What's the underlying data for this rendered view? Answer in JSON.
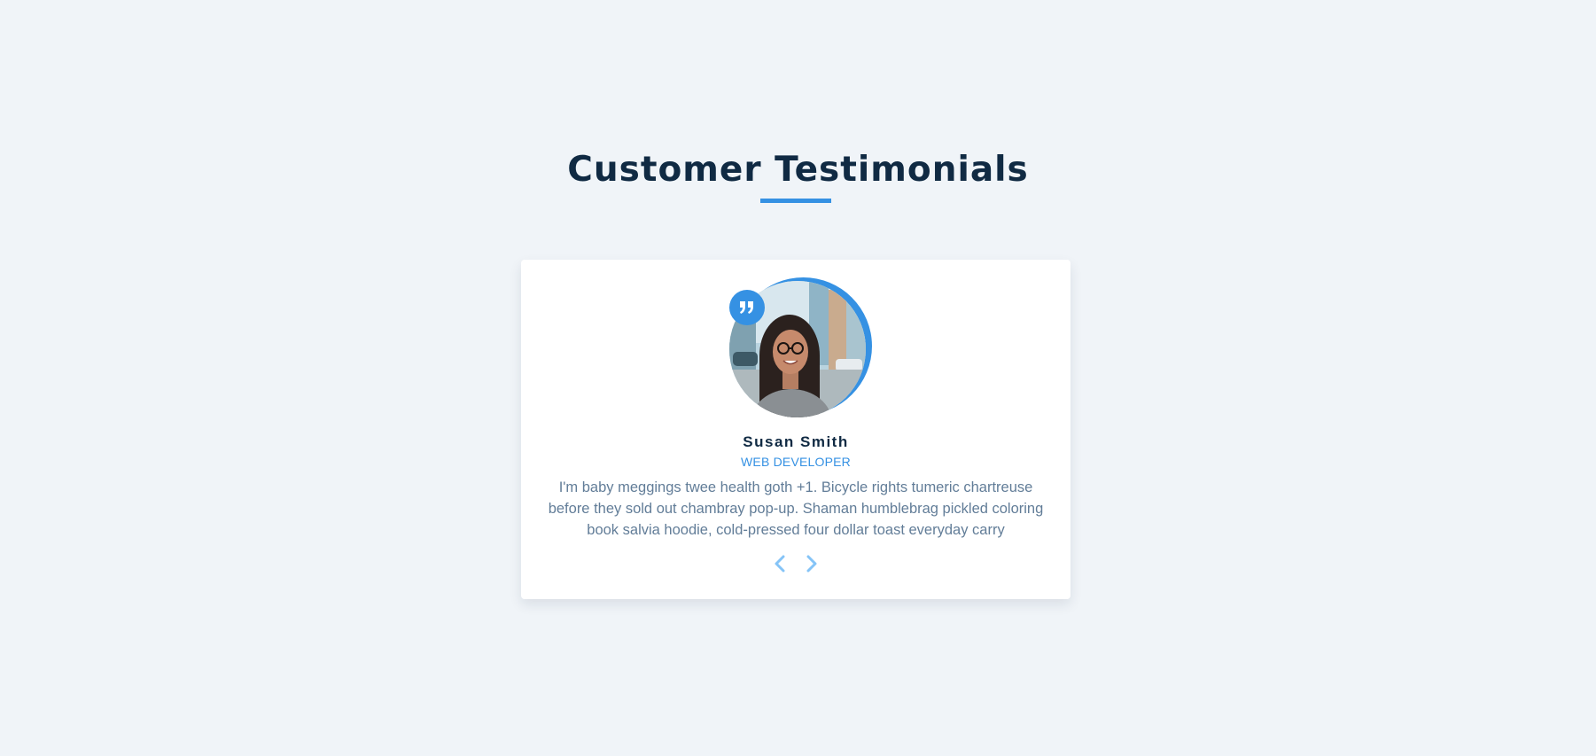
{
  "section": {
    "title": "Customer Testimonials",
    "accent_color": "#3591e3"
  },
  "testimonial": {
    "name": "Susan Smith",
    "job": "WEB DEVELOPER",
    "text": "I'm baby meggings twee health goth +1. Bicycle rights tumeric chartreuse before they sold out chambray pop-up. Shaman humblebrag pickled coloring book salvia hoodie, cold-pressed four dollar toast everyday carry",
    "avatar": "person-photo",
    "quote_icon": "quote-icon"
  },
  "nav": {
    "prev_icon": "chevron-left-icon",
    "next_icon": "chevron-right-icon"
  },
  "colors": {
    "background": "#f0f4f8",
    "card": "#ffffff",
    "heading": "#102a43",
    "body_text": "#627d98",
    "accent": "#3591e3",
    "nav_arrow": "#85c4f7"
  }
}
